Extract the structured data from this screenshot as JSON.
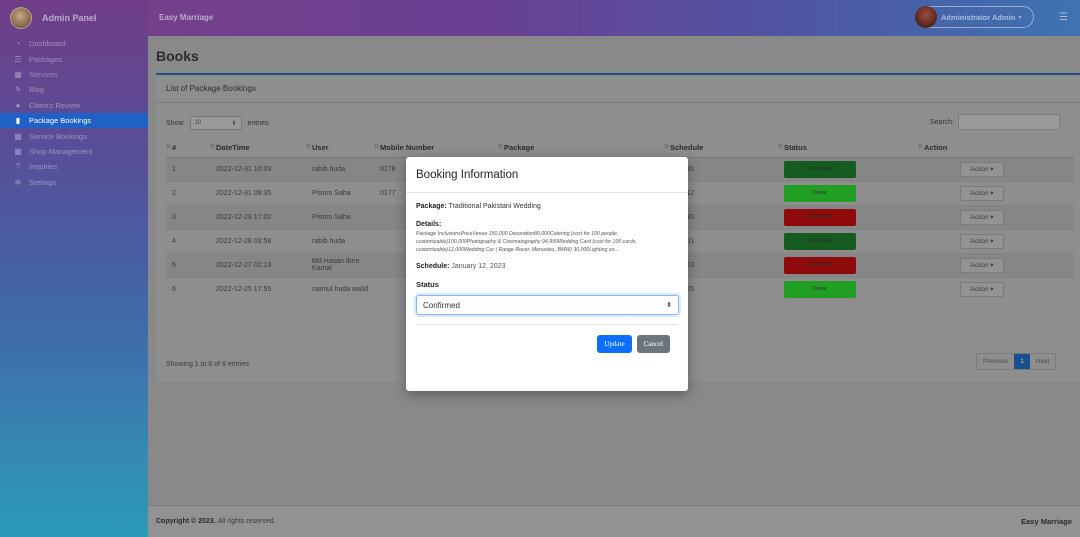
{
  "sidebar": {
    "brand": "Admin Panel",
    "items": [
      {
        "label": "Dashboard",
        "icon": "dashboard-icon",
        "glyph": "◔",
        "active": false
      },
      {
        "label": "Packages",
        "icon": "packages-icon",
        "glyph": "☰",
        "active": false
      },
      {
        "label": "Services",
        "icon": "gift-icon",
        "glyph": "▦",
        "active": false
      },
      {
        "label": "Blog",
        "icon": "blog-icon",
        "glyph": "✎",
        "active": false
      },
      {
        "label": "Client's Review",
        "icon": "comments-icon",
        "glyph": "●",
        "active": false
      },
      {
        "label": "Package Bookings",
        "icon": "bookmark-icon",
        "glyph": "▮",
        "active": true
      },
      {
        "label": "Service Bookings",
        "icon": "calendar-icon",
        "glyph": "▦",
        "active": false
      },
      {
        "label": "Shop Management",
        "icon": "shop-icon",
        "glyph": "▦",
        "active": false
      },
      {
        "label": "Inquiries",
        "icon": "question-icon",
        "glyph": "?",
        "active": false
      },
      {
        "label": "Settings",
        "icon": "settings-icon",
        "glyph": "✲",
        "active": false
      }
    ]
  },
  "topbar": {
    "title": "Easy Marriage",
    "user": "Administrator Admin",
    "menu_glyph": "☰"
  },
  "page": {
    "title": "Books",
    "card_title": "List of Package Bookings",
    "show_label": "Show",
    "entries_label": "entries",
    "length_value": "10",
    "search_label": "Search:",
    "info": "Showing 1 to 6 of 6 entries",
    "pager": {
      "previous": "Previous",
      "current": "1",
      "next": "Next"
    }
  },
  "table": {
    "headers": [
      "#",
      "DateTime",
      "User",
      "Mobile Number",
      "Package",
      "Schedule",
      "Status",
      "Action"
    ],
    "rows": [
      {
        "num": "1",
        "datetime": "2022-12-31 10:03",
        "user": "rabib huda",
        "mobile": "0178",
        "package": "",
        "schedule": "2-12-31",
        "status": "Confirmed",
        "status_class": "st-confirmed",
        "action": "Action ▾"
      },
      {
        "num": "2",
        "datetime": "2022-12-31 09:35",
        "user": "Pritom Saha",
        "mobile": "0177",
        "package": "",
        "schedule": "3-01-12",
        "status": "Done",
        "status_class": "st-done",
        "action": "Action ▾"
      },
      {
        "num": "3",
        "datetime": "2022-12-29 17:02",
        "user": "Pritom Saha",
        "mobile": "",
        "package": "",
        "schedule": "2-12-30",
        "status": "Cancelled",
        "status_class": "st-cancelled",
        "action": "Action ▾"
      },
      {
        "num": "4",
        "datetime": "2022-12-28 03:58",
        "user": "rabib huda",
        "mobile": "",
        "package": "",
        "schedule": "3-02-01",
        "status": "Confirmed",
        "status_class": "st-confirmed",
        "action": "Action ▾"
      },
      {
        "num": "5",
        "datetime": "2022-12-27 02:13",
        "user": "Md Hasan Ibne Kamal",
        "mobile": "",
        "package": "",
        "schedule": "3-01-23",
        "status": "Cancelled",
        "status_class": "st-cancelled",
        "action": "Action ▾"
      },
      {
        "num": "6",
        "datetime": "2022-12-25 17:55",
        "user": "naimul huda walid",
        "mobile": "",
        "package": "",
        "schedule": "2-12-25",
        "status": "Done",
        "status_class": "st-done",
        "action": "Action ▾"
      }
    ]
  },
  "modal": {
    "title": "Booking Information",
    "package_label": "Package:",
    "package_value": "Traditional Pakistani Wedding",
    "details_label": "Details:",
    "details_text": "Package InclusionsPriceVenue 150,000 Decoration80,000Catering (cost for 100 people, customizable)100,000Photography & Cinematography 94,999Wedding Card (cost for 100 cards, customizable)12,000Wedding Car ( Range Rover, Mercedes, BMW) 30,000Lighting an...",
    "schedule_label": "Schedule:",
    "schedule_value": "January 12, 2023",
    "status_label": "Status",
    "status_value": "Confirmed",
    "update_label": "Update",
    "cancel_label": "Cancel"
  },
  "footer": {
    "copyright_prefix": "Copyright © 2023.",
    "copyright_suffix": "All rights reserved.",
    "brand": "Easy Marriage"
  }
}
